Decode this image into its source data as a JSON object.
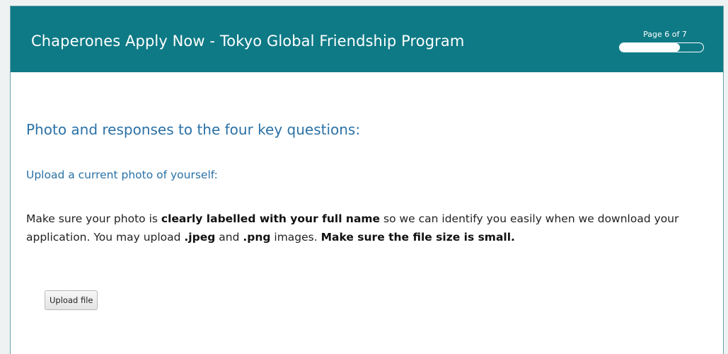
{
  "header": {
    "title": "Chaperones Apply Now - Tokyo Global Friendship Program",
    "progress": {
      "label": "Page 6 of 7",
      "current_page": 6,
      "total_pages": 7,
      "fraction": 0.72
    },
    "background_color": "#0e7a86"
  },
  "main": {
    "section_title": "Photo and responses to the four key questions:",
    "upload_prompt": "Upload a current photo of yourself:",
    "instructions": {
      "part1": "Make sure your photo is ",
      "part2_bold": "clearly labelled with your full name",
      "part3": " so we can identify you easily when we download your application. You may upload ",
      "part4_bold": ".jpeg",
      "part5": " and ",
      "part6_bold": ".png",
      "part7": " images. ",
      "part8_bold": "Make sure the file size is small."
    },
    "upload_button_label": "Upload file"
  },
  "colors": {
    "heading": "#2a71a6",
    "text": "#222222"
  }
}
